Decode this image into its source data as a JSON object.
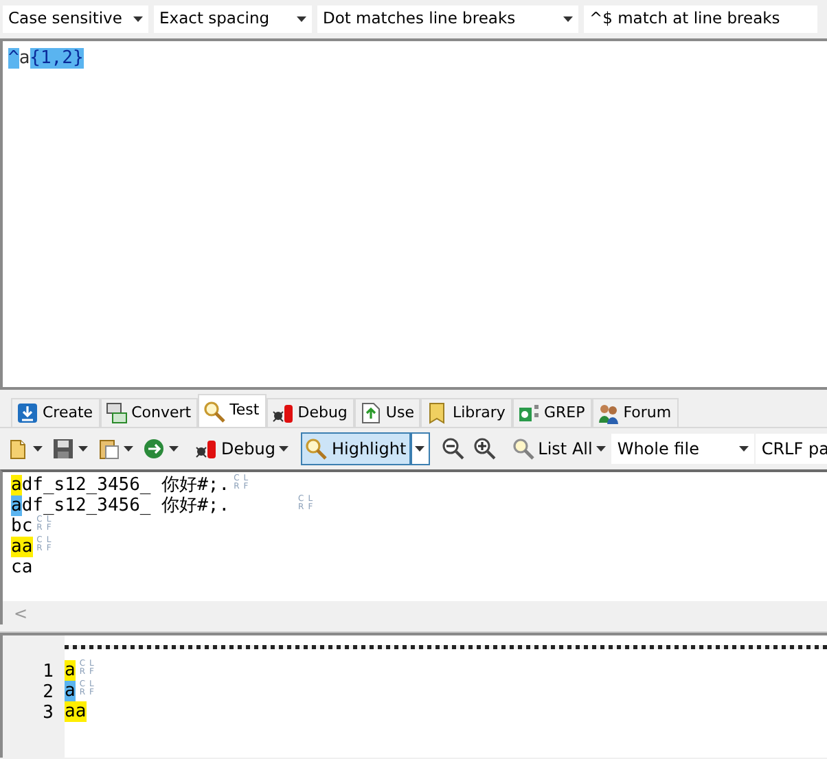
{
  "options": [
    {
      "label": "Case sensitive",
      "arrow": true
    },
    {
      "label": "Exact spacing",
      "arrow": true
    },
    {
      "label": "Dot matches line breaks",
      "arrow": true
    },
    {
      "label": "^$ match at line breaks",
      "arrow": false
    }
  ],
  "regex": [
    {
      "text": "^",
      "selected": true
    },
    {
      "text": "a",
      "selected": false
    },
    {
      "text": "{1,2}",
      "selected": true
    }
  ],
  "tabs": [
    {
      "label": "Create",
      "selected": false
    },
    {
      "label": "Convert",
      "selected": false
    },
    {
      "label": "Test",
      "selected": true
    },
    {
      "label": "Debug",
      "selected": false
    },
    {
      "label": "Use",
      "selected": false
    },
    {
      "label": "Library",
      "selected": false
    },
    {
      "label": "GREP",
      "selected": false
    },
    {
      "label": "Forum",
      "selected": false
    }
  ],
  "toolbar": [
    {
      "kind": "icon-menu"
    },
    {
      "kind": "icon-menu"
    },
    {
      "kind": "icon-menu"
    },
    {
      "kind": "icon-menu"
    },
    {
      "kind": "separator"
    },
    {
      "kind": "button-menu",
      "label": "Debug"
    },
    {
      "kind": "separator"
    },
    {
      "kind": "split",
      "label": "Highlight",
      "pressed": true
    },
    {
      "kind": "separator"
    },
    {
      "kind": "icon"
    },
    {
      "kind": "icon"
    },
    {
      "kind": "separator"
    },
    {
      "kind": "button-menu",
      "label": "List All"
    },
    {
      "kind": "select",
      "label": "Whole file"
    },
    {
      "kind": "text",
      "label": "CRLF pa"
    }
  ],
  "subject": [
    {
      "segments": [
        {
          "text": "a",
          "color": "#ffee00"
        },
        {
          "text": "df_s12_3456_ 你好#;."
        }
      ],
      "eol": "CRLF"
    },
    {
      "segments": [
        {
          "text": "a",
          "color": "#5ab4f0"
        },
        {
          "text": "df_s12_3456_ 你好#;.      "
        }
      ],
      "eol": "CRLF"
    },
    {
      "segments": [
        {
          "text": "bc"
        }
      ],
      "eol": "CRLF"
    },
    {
      "segments": [
        {
          "text": "aa",
          "color": "#ffee00"
        }
      ],
      "eol": "CRLF"
    },
    {
      "segments": [
        {
          "text": "ca"
        }
      ]
    }
  ],
  "scroll_left": "<",
  "results": [
    {
      "number": "1",
      "segments": [
        {
          "text": "a",
          "color": "#ffee00"
        }
      ],
      "eol": "CRLF"
    },
    {
      "number": "2",
      "segments": [
        {
          "text": "a",
          "color": "#5ab4f0"
        }
      ],
      "eol": "CRLF"
    },
    {
      "number": "3",
      "segments": [
        {
          "text": "aa",
          "color": "#ffee00"
        }
      ]
    }
  ]
}
